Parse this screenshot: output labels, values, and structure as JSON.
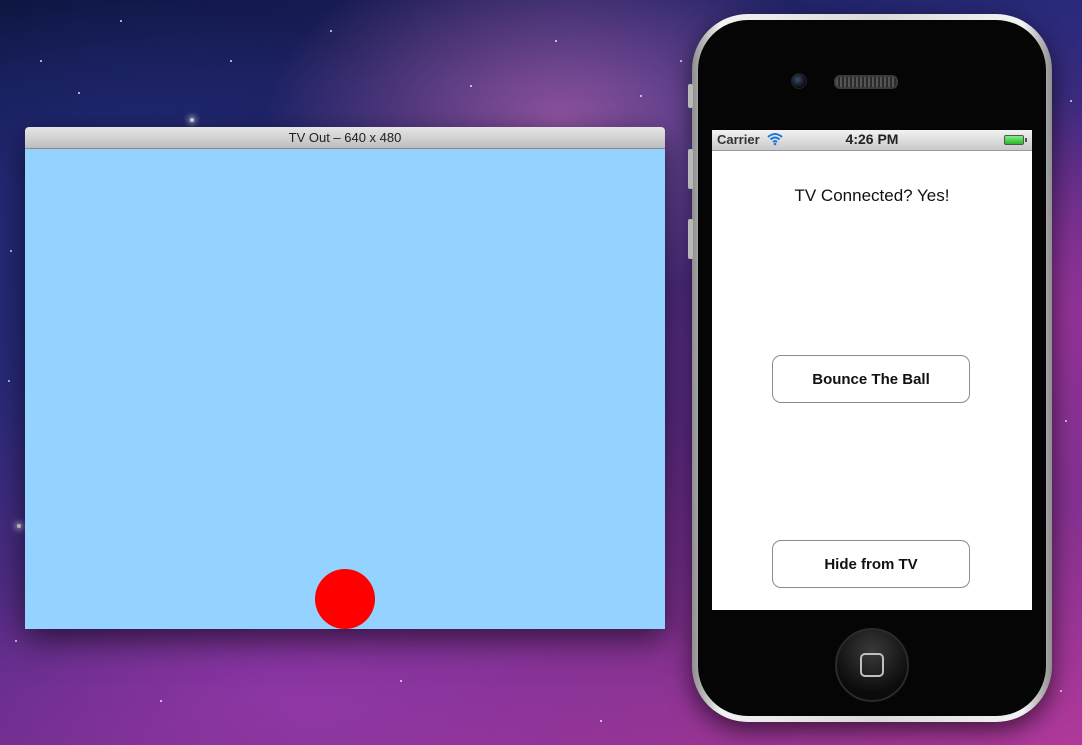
{
  "tv_window": {
    "title": "TV Out – 640 x 480",
    "background_color": "#94d2ff",
    "ball_color": "#ff0000"
  },
  "phone": {
    "status_bar": {
      "carrier": "Carrier",
      "time": "4:26 PM",
      "wifi_icon": "wifi-icon",
      "battery_icon": "battery-icon"
    },
    "tv_status_label": "TV Connected? Yes!",
    "buttons": {
      "bounce": "Bounce The Ball",
      "hide": "Hide from TV"
    },
    "home_button_icon": "home-button-icon"
  }
}
